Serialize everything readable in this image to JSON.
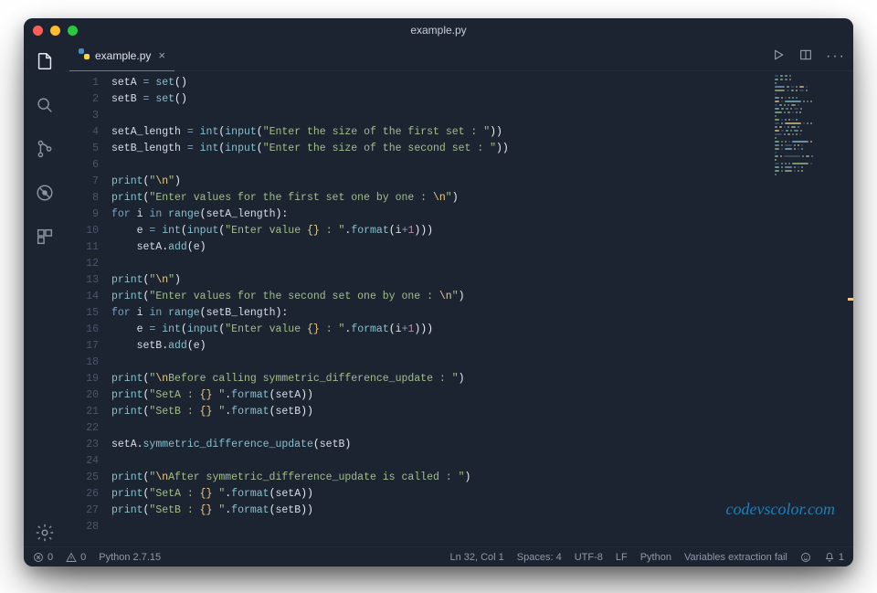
{
  "window": {
    "title": "example.py"
  },
  "tabs": [
    {
      "label": "example.py",
      "icon": "🐍",
      "close": "×"
    }
  ],
  "code": {
    "lines": [
      {
        "n": "1",
        "seg": [
          [
            "id",
            "setA"
          ],
          [
            "op",
            " = "
          ],
          [
            "fn",
            "set"
          ],
          [
            "pun",
            "()"
          ]
        ]
      },
      {
        "n": "2",
        "seg": [
          [
            "id",
            "setB"
          ],
          [
            "op",
            " = "
          ],
          [
            "fn",
            "set"
          ],
          [
            "pun",
            "()"
          ]
        ]
      },
      {
        "n": "3",
        "seg": []
      },
      {
        "n": "4",
        "seg": [
          [
            "id",
            "setA_length"
          ],
          [
            "op",
            " = "
          ],
          [
            "fn",
            "int"
          ],
          [
            "pun",
            "("
          ],
          [
            "fn",
            "input"
          ],
          [
            "pun",
            "("
          ],
          [
            "str",
            "\"Enter the size of the first set : \""
          ],
          [
            "pun",
            "))"
          ]
        ]
      },
      {
        "n": "5",
        "seg": [
          [
            "id",
            "setB_length"
          ],
          [
            "op",
            " = "
          ],
          [
            "fn",
            "int"
          ],
          [
            "pun",
            "("
          ],
          [
            "fn",
            "input"
          ],
          [
            "pun",
            "("
          ],
          [
            "str",
            "\"Enter the size of the second set : \""
          ],
          [
            "pun",
            "))"
          ]
        ]
      },
      {
        "n": "6",
        "seg": []
      },
      {
        "n": "7",
        "seg": [
          [
            "fn",
            "print"
          ],
          [
            "pun",
            "("
          ],
          [
            "str",
            "\""
          ],
          [
            "esc",
            "\\n"
          ],
          [
            "str",
            "\""
          ],
          [
            "pun",
            ")"
          ]
        ]
      },
      {
        "n": "8",
        "seg": [
          [
            "fn",
            "print"
          ],
          [
            "pun",
            "("
          ],
          [
            "str",
            "\"Enter values for the first set one by one : "
          ],
          [
            "esc",
            "\\n"
          ],
          [
            "str",
            "\""
          ],
          [
            "pun",
            ")"
          ]
        ]
      },
      {
        "n": "9",
        "seg": [
          [
            "kw",
            "for"
          ],
          [
            "id",
            " i "
          ],
          [
            "kw",
            "in"
          ],
          [
            "id",
            " "
          ],
          [
            "fn",
            "range"
          ],
          [
            "pun",
            "("
          ],
          [
            "id",
            "setA_length"
          ],
          [
            "pun",
            "):"
          ]
        ]
      },
      {
        "n": "10",
        "seg": [
          [
            "id",
            "    e"
          ],
          [
            "op",
            " = "
          ],
          [
            "fn",
            "int"
          ],
          [
            "pun",
            "("
          ],
          [
            "fn",
            "input"
          ],
          [
            "pun",
            "("
          ],
          [
            "str",
            "\"Enter value "
          ],
          [
            "esc",
            "{}"
          ],
          [
            "str",
            " : \""
          ],
          [
            "pun",
            "."
          ],
          [
            "meth",
            "format"
          ],
          [
            "pun",
            "("
          ],
          [
            "id",
            "i"
          ],
          [
            "op",
            "+"
          ],
          [
            "num",
            "1"
          ],
          [
            "pun",
            ")))"
          ]
        ]
      },
      {
        "n": "11",
        "seg": [
          [
            "id",
            "    setA"
          ],
          [
            "pun",
            "."
          ],
          [
            "meth",
            "add"
          ],
          [
            "pun",
            "("
          ],
          [
            "id",
            "e"
          ],
          [
            "pun",
            ")"
          ]
        ]
      },
      {
        "n": "12",
        "seg": []
      },
      {
        "n": "13",
        "seg": [
          [
            "fn",
            "print"
          ],
          [
            "pun",
            "("
          ],
          [
            "str",
            "\""
          ],
          [
            "esc",
            "\\n"
          ],
          [
            "str",
            "\""
          ],
          [
            "pun",
            ")"
          ]
        ]
      },
      {
        "n": "14",
        "seg": [
          [
            "fn",
            "print"
          ],
          [
            "pun",
            "("
          ],
          [
            "str",
            "\"Enter values for the second set one by one : "
          ],
          [
            "esc",
            "\\n"
          ],
          [
            "str",
            "\""
          ],
          [
            "pun",
            ")"
          ]
        ]
      },
      {
        "n": "15",
        "seg": [
          [
            "kw",
            "for"
          ],
          [
            "id",
            " i "
          ],
          [
            "kw",
            "in"
          ],
          [
            "id",
            " "
          ],
          [
            "fn",
            "range"
          ],
          [
            "pun",
            "("
          ],
          [
            "id",
            "setB_length"
          ],
          [
            "pun",
            "):"
          ]
        ]
      },
      {
        "n": "16",
        "seg": [
          [
            "id",
            "    e"
          ],
          [
            "op",
            " = "
          ],
          [
            "fn",
            "int"
          ],
          [
            "pun",
            "("
          ],
          [
            "fn",
            "input"
          ],
          [
            "pun",
            "("
          ],
          [
            "str",
            "\"Enter value "
          ],
          [
            "esc",
            "{}"
          ],
          [
            "str",
            " : \""
          ],
          [
            "pun",
            "."
          ],
          [
            "meth",
            "format"
          ],
          [
            "pun",
            "("
          ],
          [
            "id",
            "i"
          ],
          [
            "op",
            "+"
          ],
          [
            "num",
            "1"
          ],
          [
            "pun",
            ")))"
          ]
        ]
      },
      {
        "n": "17",
        "seg": [
          [
            "id",
            "    setB"
          ],
          [
            "pun",
            "."
          ],
          [
            "meth",
            "add"
          ],
          [
            "pun",
            "("
          ],
          [
            "id",
            "e"
          ],
          [
            "pun",
            ")"
          ]
        ]
      },
      {
        "n": "18",
        "seg": []
      },
      {
        "n": "19",
        "seg": [
          [
            "fn",
            "print"
          ],
          [
            "pun",
            "("
          ],
          [
            "str",
            "\""
          ],
          [
            "esc",
            "\\n"
          ],
          [
            "str",
            "Before calling symmetric_difference_update : \""
          ],
          [
            "pun",
            ")"
          ]
        ]
      },
      {
        "n": "20",
        "seg": [
          [
            "fn",
            "print"
          ],
          [
            "pun",
            "("
          ],
          [
            "str",
            "\"SetA : "
          ],
          [
            "esc",
            "{}"
          ],
          [
            "str",
            " \""
          ],
          [
            "pun",
            "."
          ],
          [
            "meth",
            "format"
          ],
          [
            "pun",
            "("
          ],
          [
            "id",
            "setA"
          ],
          [
            "pun",
            "))"
          ]
        ]
      },
      {
        "n": "21",
        "seg": [
          [
            "fn",
            "print"
          ],
          [
            "pun",
            "("
          ],
          [
            "str",
            "\"SetB : "
          ],
          [
            "esc",
            "{}"
          ],
          [
            "str",
            " \""
          ],
          [
            "pun",
            "."
          ],
          [
            "meth",
            "format"
          ],
          [
            "pun",
            "("
          ],
          [
            "id",
            "setB"
          ],
          [
            "pun",
            "))"
          ]
        ]
      },
      {
        "n": "22",
        "seg": []
      },
      {
        "n": "23",
        "seg": [
          [
            "id",
            "setA"
          ],
          [
            "pun",
            "."
          ],
          [
            "meth",
            "symmetric_difference_update"
          ],
          [
            "pun",
            "("
          ],
          [
            "id",
            "setB"
          ],
          [
            "pun",
            ")"
          ]
        ]
      },
      {
        "n": "24",
        "seg": []
      },
      {
        "n": "25",
        "seg": [
          [
            "fn",
            "print"
          ],
          [
            "pun",
            "("
          ],
          [
            "str",
            "\""
          ],
          [
            "esc",
            "\\n"
          ],
          [
            "str",
            "After symmetric_difference_update is called : \""
          ],
          [
            "pun",
            ")"
          ]
        ]
      },
      {
        "n": "26",
        "seg": [
          [
            "fn",
            "print"
          ],
          [
            "pun",
            "("
          ],
          [
            "str",
            "\"SetA : "
          ],
          [
            "esc",
            "{}"
          ],
          [
            "str",
            " \""
          ],
          [
            "pun",
            "."
          ],
          [
            "meth",
            "format"
          ],
          [
            "pun",
            "("
          ],
          [
            "id",
            "setA"
          ],
          [
            "pun",
            "))"
          ]
        ]
      },
      {
        "n": "27",
        "seg": [
          [
            "fn",
            "print"
          ],
          [
            "pun",
            "("
          ],
          [
            "str",
            "\"SetB : "
          ],
          [
            "esc",
            "{}"
          ],
          [
            "str",
            " \""
          ],
          [
            "pun",
            "."
          ],
          [
            "meth",
            "format"
          ],
          [
            "pun",
            "("
          ],
          [
            "id",
            "setB"
          ],
          [
            "pun",
            "))"
          ]
        ]
      },
      {
        "n": "28",
        "seg": []
      }
    ]
  },
  "watermark": "codevscolor.com",
  "status": {
    "errors": "0",
    "warnings": "0",
    "python_version": "Python 2.7.15",
    "cursor": "Ln 32, Col 1",
    "spaces": "Spaces: 4",
    "encoding": "UTF-8",
    "eol": "LF",
    "language": "Python",
    "extra": "Variables extraction fail",
    "bell_count": "1"
  }
}
